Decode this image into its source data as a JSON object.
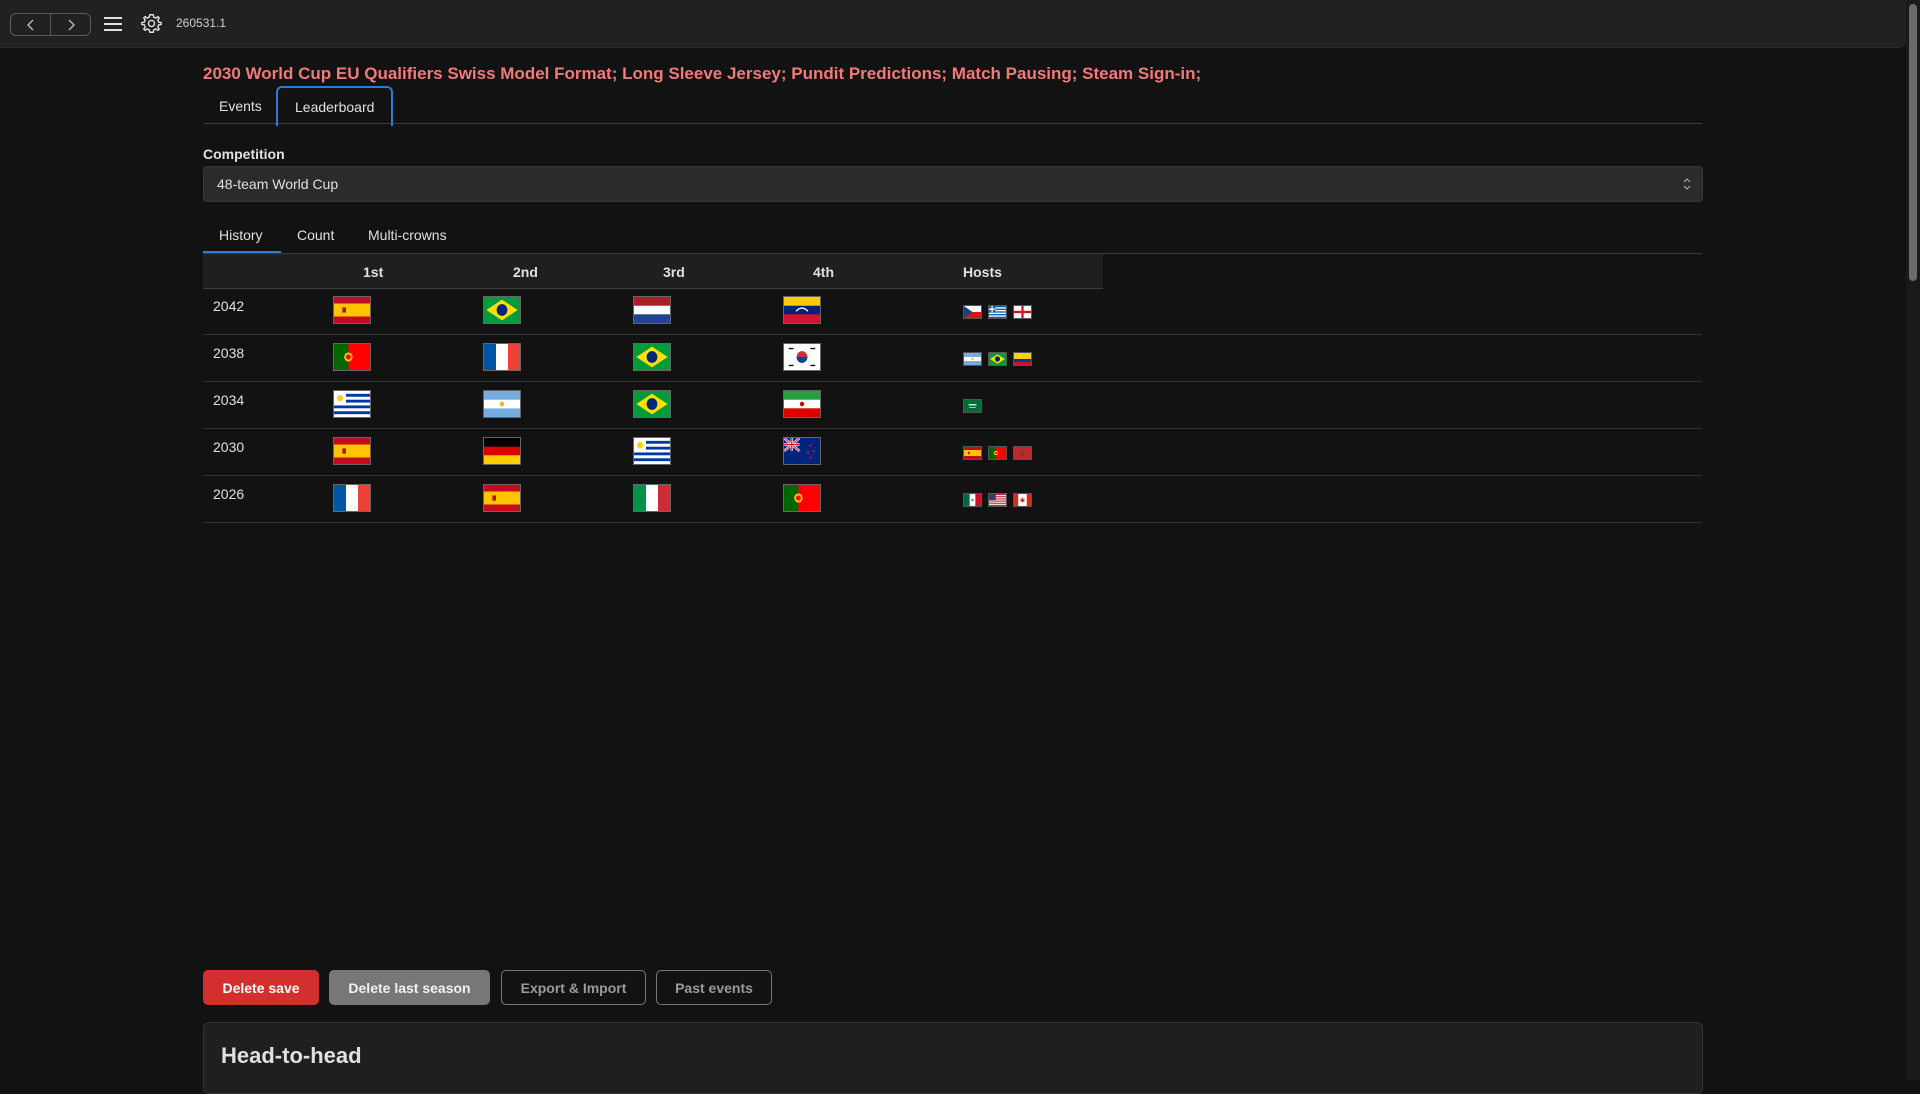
{
  "app": {
    "version": "260531.1"
  },
  "page": {
    "title": "2030 World Cup EU Qualifiers Swiss Model Format; Long Sleeve Jersey; Pundit Predictions; Match Pausing; Steam Sign-in;"
  },
  "main_tabs": [
    {
      "label": "Events"
    },
    {
      "label": "Leaderboard",
      "active": true
    }
  ],
  "competition": {
    "label": "Competition",
    "value": "48-team World Cup"
  },
  "sub_tabs": [
    {
      "label": "History",
      "active": true
    },
    {
      "label": "Count"
    },
    {
      "label": "Multi-crowns"
    }
  ],
  "table": {
    "headers": [
      "",
      "1st",
      "2nd",
      "3rd",
      "4th",
      "Hosts"
    ],
    "rows": [
      {
        "year": "2042",
        "places": [
          "Spain",
          "Brazil",
          "Netherlands",
          "Venezuela"
        ],
        "hosts": [
          "Czechia",
          "Greece",
          "England"
        ]
      },
      {
        "year": "2038",
        "places": [
          "Portugal",
          "France",
          "Brazil",
          "South Korea"
        ],
        "hosts": [
          "Argentina",
          "Brazil",
          "Colombia"
        ]
      },
      {
        "year": "2034",
        "places": [
          "Uruguay",
          "Argentina",
          "Brazil",
          "Iran"
        ],
        "hosts": [
          "Saudi Arabia"
        ]
      },
      {
        "year": "2030",
        "places": [
          "Spain",
          "Germany",
          "Uruguay",
          "New Zealand"
        ],
        "hosts": [
          "Spain",
          "Portugal",
          "Morocco"
        ]
      },
      {
        "year": "2026",
        "places": [
          "France",
          "Spain",
          "Italy",
          "Portugal"
        ],
        "hosts": [
          "Mexico",
          "USA",
          "Canada"
        ]
      }
    ]
  },
  "actions": {
    "delete_save": "Delete save",
    "delete_last_season": "Delete last season",
    "export_import": "Export & Import",
    "past_events": "Past events"
  },
  "head_to_head": {
    "title": "Head-to-head"
  },
  "colors": {
    "accent": "#2e7cd6",
    "title": "#f07a78",
    "danger": "#d32f2f"
  }
}
